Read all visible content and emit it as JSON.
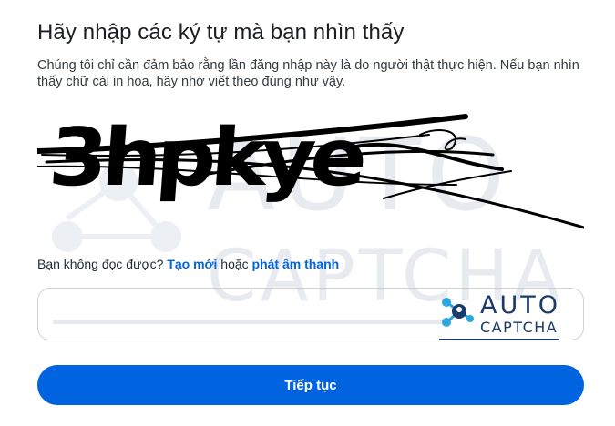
{
  "heading": "Hãy nhập các ký tự mà bạn nhìn thấy",
  "description": "Chúng tôi chỉ cần đảm bảo rằng lần đăng nhập này là do người thật thực hiện. Nếu bạn nhìn thấy chữ cái in hoa, hãy nhớ viết theo đúng như vậy.",
  "captcha": {
    "text": "3hpkye"
  },
  "watermark": {
    "line1": "AUTO",
    "line2": "CAPTCHA"
  },
  "alternatives": {
    "prefix": "Bạn không đọc được?",
    "refresh_link": "Tạo mới",
    "or": "hoặc",
    "audio_link": "phát âm thanh"
  },
  "input": {
    "value": "",
    "placeholder": ""
  },
  "badge": {
    "line1": "AUTO",
    "line2": "CAPTCHA"
  },
  "continue_button": "Tiếp tục",
  "colors": {
    "accent": "#0064e0",
    "watermark": "#dde3ea",
    "badge": "#1a3a6b",
    "badge_icon": "#2aa6e0"
  }
}
